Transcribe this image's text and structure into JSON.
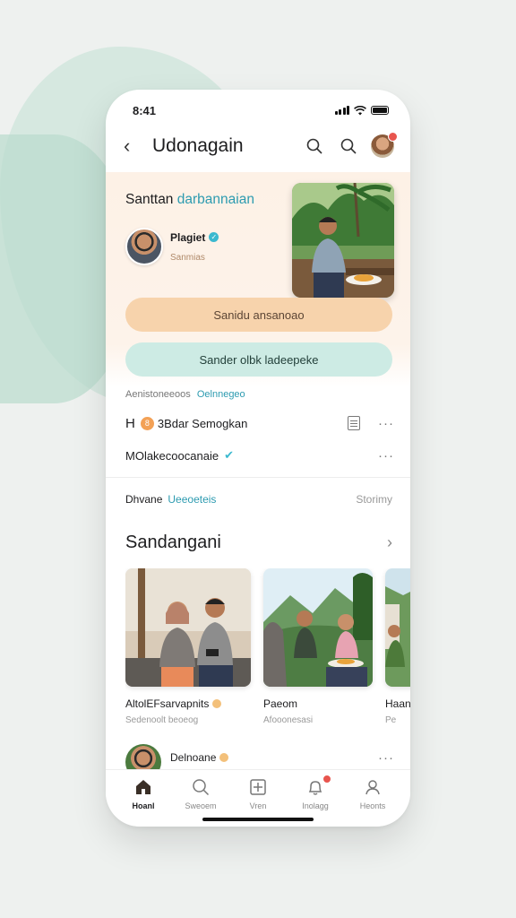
{
  "status_bar": {
    "time": "8:41"
  },
  "header": {
    "title": "Udonagain"
  },
  "hero": {
    "title_main": "Santtan",
    "title_accent": "darbannaian",
    "profile_name": "Plagiet",
    "profile_sub": "Sanmias"
  },
  "buttons": {
    "primary_label": "Sanidu ansanoao",
    "secondary_label": "Sander olbk ladeepeke"
  },
  "meta": {
    "label": "Aenistoneeoos",
    "accent": "Oelnnegeo"
  },
  "rows": [
    {
      "prefix": "H",
      "badge": "8",
      "label": "3Bdar Semogkan"
    },
    {
      "label": "MOlakecoocanaie"
    }
  ],
  "filter": {
    "label": "Dhvane",
    "accent": "Ueeoeteis",
    "right": "Storimy"
  },
  "section": {
    "title": "Sandangani"
  },
  "cards": [
    {
      "title": "AltolEFsarvapnits",
      "sub": "Sedenoolt beoeog"
    },
    {
      "title": "Paeom",
      "sub": "Afooonesasi"
    },
    {
      "title": "Haan",
      "sub": "Pe"
    }
  ],
  "bottom_item": {
    "name": "Delnoane"
  },
  "tabs": [
    {
      "label": "Hoanl"
    },
    {
      "label": "Sweoem"
    },
    {
      "label": "Vren"
    },
    {
      "label": "Inolagg"
    },
    {
      "label": "Heonts"
    }
  ],
  "colors": {
    "accent": "#2d9bb0",
    "peach": "#f7d3ac",
    "mint": "#cdebe4",
    "badge": "#e8554e"
  }
}
